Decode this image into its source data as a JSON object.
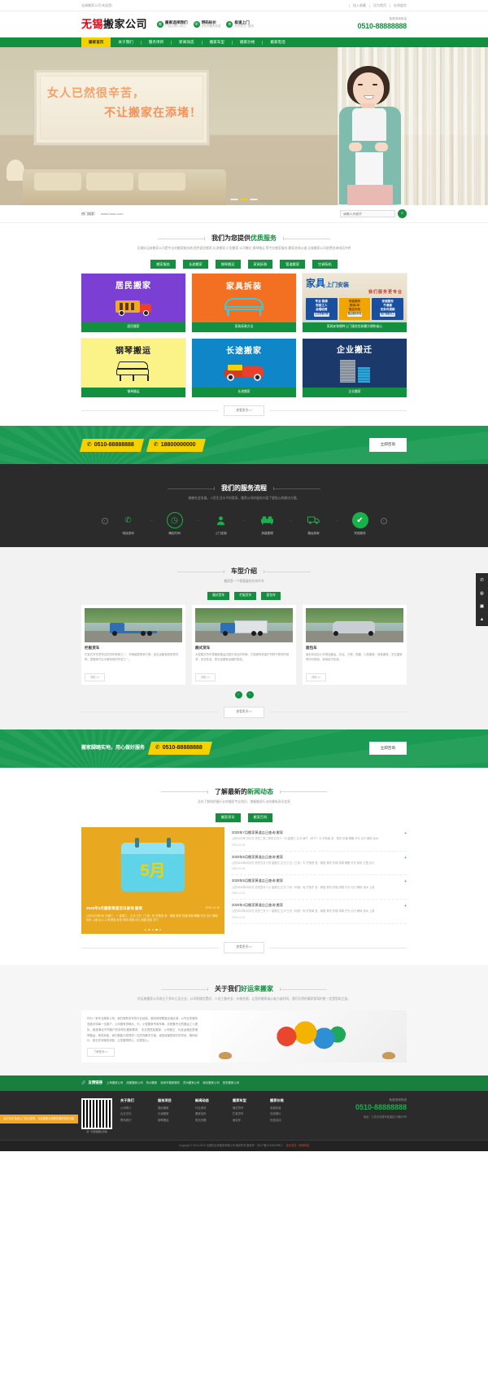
{
  "topbar": {
    "left": "无锡搬家公司 欢迎您!",
    "links": [
      "加入收藏",
      "设为首页",
      "在线留言"
    ]
  },
  "header": {
    "logo_red": "无锡",
    "logo_black": "搬家公司",
    "features": [
      {
        "icon": "shield-icon",
        "glyph": "搬",
        "title": "搬家选择我们",
        "sub": "一百心/舒心/安心"
      },
      {
        "icon": "price-icon",
        "glyph": "明",
        "title": "明码标价",
        "sub": "无任何隐形收费"
      },
      {
        "icon": "fast-icon",
        "glyph": "快",
        "title": "极速上门",
        "sub": "30分钟上门服务"
      }
    ],
    "phone_label": "免费咨询电话",
    "phone_number": "0510-88888888"
  },
  "nav": {
    "items": [
      "搬家首页",
      "关于我们",
      "服务项目",
      "新闻动态",
      "搬家车型",
      "搬家价格",
      "搬家电话"
    ],
    "active": "搬家首页"
  },
  "hero": {
    "line1": "女人已然很辛苦，",
    "line2": "不让搬家在添堵！",
    "slides": 3,
    "active_slide": 1
  },
  "search": {
    "hot_label": "热门搜索：",
    "hot_link": "www.huwz.com",
    "placeholder": "请输入关键字",
    "value": "",
    "button_icon": "search-icon"
  },
  "services": {
    "title_prefix": "我们为您提供",
    "title_accent": "优质服务",
    "subtitle": "无锡好运来搬家公司是专业的搬家服务商,提供居民搬家,长途搬家,小型搬家,公司搬迁,钢琴搬运,等专业搬家服务,搬家咨询公道,无锡搬家公司收费咨询电话中转",
    "tabs": [
      "搬家服务",
      "长途搬家",
      "钢琴搬运",
      "家具拆装",
      "管道搬家",
      "空调拆机"
    ],
    "cards": [
      {
        "title": "居民搬家",
        "caption": "居民搬家",
        "icon": "moving-truck-icon"
      },
      {
        "title": "家具拆装",
        "caption": "家具拆装方法",
        "icon": "bed-frame-icon"
      },
      {
        "title": "家具",
        "title2": "上门安装",
        "subtitle": "我们服务更专业",
        "caption": "家具安装哪种上门服务包装最方便和省心",
        "cols": [
          {
            "l1": "专业·熟练",
            "l2": "安装工人",
            "l3": "合理收费",
            "pill": "点击查看详情"
          },
          {
            "l1": "安装服务",
            "l2": "质保1年",
            "l3": "售后无忧",
            "pill": "售后服务到位"
          },
          {
            "l1": "安装服务",
            "l2": "不满意",
            "l3": "无条件退款",
            "pill": "客户满意至上"
          }
        ]
      },
      {
        "title": "钢琴搬运",
        "caption": "钢琴搬运",
        "icon": "piano-icon"
      },
      {
        "title": "长途搬家",
        "caption": "长途搬家",
        "icon": "pickup-truck-icon"
      },
      {
        "title": "企业搬迁",
        "caption": "企业搬家",
        "icon": "office-building-icon"
      }
    ],
    "more": "查看更多>>"
  },
  "cta1": {
    "phone1": "0510-88888888",
    "phone2": "18800000000",
    "button": "立即咨询",
    "phone_icon": "phone-icon"
  },
  "process": {
    "title": "我们的服务流程",
    "subtitle": "随着社会发展，人民生活水平的提高，搬家公司的服务内容了更贴心的解决方案。",
    "prev_icon": "chevron-left-icon",
    "next_icon": "chevron-right-icon",
    "steps": [
      {
        "label": "电话咨询",
        "icon": "phone-ring-icon",
        "glyph": "✆"
      },
      {
        "label": "确定时间",
        "icon": "clock-icon",
        "glyph": "◷"
      },
      {
        "label": "上门定制",
        "icon": "person-icon",
        "glyph": "●"
      },
      {
        "label": "拆装整理",
        "icon": "sofa-icon",
        "glyph": "▤"
      },
      {
        "label": "搬运到家",
        "icon": "delivery-truck-icon",
        "glyph": "▭"
      },
      {
        "label": "完成服务",
        "icon": "check-circle-icon",
        "glyph": "✔"
      }
    ]
  },
  "vehicles": {
    "title": "车型介绍",
    "subtitle": "搬家是一个需要量的任何环节",
    "tabs": [
      "厢式货车",
      "栏板货车",
      "面包车"
    ],
    "cards": [
      {
        "name": "栏板货车",
        "desc": "栏板式货车是常见的货车种类之一，车辆装载简单方便，适合运输各种常规货物，是搬家作业中最常用的车型之一。",
        "detail": "详情 >>",
        "type": "flat"
      },
      {
        "name": "厢式货车",
        "desc": "大型厢式货车是搬家搬运过程中常见的车辆，它能够有效保护货物不受风吹雨淋，安全性高，是长途搬家运输的首选。",
        "detail": "详情 >>",
        "type": "box"
      },
      {
        "name": "面包车",
        "desc": "面包车适合小件物品搬运，灵活、方便、快捷。小型搬家、宿舍搬家、学生搬家等均可使用，费用经济实惠。",
        "detail": "详情 >>",
        "type": "van"
      }
    ],
    "prev_icon": "chevron-left-icon",
    "next_icon": "chevron-right-icon",
    "more": "查看更多>>",
    "sidebar_icons": [
      "phone-icon",
      "qq-icon",
      "wechat-icon",
      "top-icon"
    ]
  },
  "cta2": {
    "slogan": "搬家脚踏实地，用心做好服务",
    "phone": "0510-88888888",
    "button": "立即咨询",
    "phone_icon": "phone-icon"
  },
  "news": {
    "title_prefix": "了解最新的",
    "title_accent": "新闻动态",
    "subtitle": "及时了解和把握行业的搬家专业知识，掌握搬家行业的最新资讯信息",
    "tabs": [
      "搬家资讯",
      "搬家百科"
    ],
    "feature": {
      "month": "5月",
      "title": "2020年5月搬家黄道吉日查询 搬家",
      "date": "2019-12-10",
      "text": "公历2020年5月 日期三：一 星期三，正冲 己巳（丁亥）蛇 岁煞西 宜：嫁娶 祭祀 祈福 求嗣 斋醮 开光 出行 解除 伐木 上梁 出火 入宅 移徙 安床 拆卸 修造 动土 起基 竖柱 安门",
      "dots": 5,
      "active_dot": 3
    },
    "items": [
      {
        "title": "2020年7月搬家黄道吉日查询 搬家",
        "text": "公历2020年7月1日 农历二零二零年五月十一日 星期三 正冲 庚午（甲子）马 岁煞南 宜：祭祀 祈福 斋醮 开光 出行 解除 伐木",
        "date": "2020-01-05"
      },
      {
        "title": "2020年6月搬家黄道吉日查询 搬家",
        "text": "公历2020年6月5日 农历五月十四 星期五 正冲 乙丑（己未）牛 岁煞西 宜：嫁娶 祭祀 祈福 求嗣 斋醮 开光 纳采 订盟 出行",
        "date": "2020-01-05"
      },
      {
        "title": "2020年5月搬家黄道吉日查询 搬家",
        "text": "公历2020年5月8日 农历四月十六 星期五 正冲 丁卯（辛酉）兔 岁煞东 宜：嫁娶 祭祀 祈福 求嗣 开光 出行 解除 伐木 上梁",
        "date": "2020-12-10"
      },
      {
        "title": "2020年4月搬家黄道吉日查询 搬家",
        "text": "公历2020年4月3日 农历三月十一 星期五 正冲 壬戌（丙辰）狗 岁煞南 宜：嫁娶 祭祀 祈福 求嗣 开光 出行 解除 伐木 上梁",
        "date": "2019-12-10"
      }
    ],
    "more": "查看更多>>"
  },
  "about": {
    "title_prefix": "关于我们",
    "title_accent": "好运来搬家",
    "subtitle": "好运来搬家公司成立于多年立足企业，公司地理位置好，人员工备齐全，价格合理，让您的搬家省心省力省时间，我们为您的搬家保驾护航一定是您的之选。",
    "text": "作为一家专业搬家公司，我们拥有多年的行业经验，服务网络覆盖全城区域，以专业的服务态度对待每一位客户。公司拥有多辆大、中、小型搬家专用车辆，并配备专业的搬运工人团队，能够满足不同客户的多样化搬家需求。\n无论是居民搬家、公司搬迁、长途运输还是钢琴搬运、家具拆装，我们都能为您提供一站式的解决方案。诚信经营是我们的宗旨，明码标价，绝无任何隐性消费，让您搬得舒心、住得放心。",
    "button": "了解更多>>"
  },
  "links": {
    "title": "友情链接",
    "icon": "link-icon",
    "items": [
      "上海搬家公司",
      "成都搬家公司",
      "杭州搬家",
      "深圳市搬家服务",
      "苏州搬家公司",
      "南京搬家公司",
      "西安搬家公司"
    ]
  },
  "footer": {
    "qr_caption": "扫一扫添加微信咨询",
    "columns": [
      {
        "title": "关于我们",
        "items": [
          "公司简介",
          "企业文化",
          "联系我们"
        ]
      },
      {
        "title": "服务项目",
        "items": [
          "居民搬家",
          "长途搬家",
          "钢琴搬运"
        ]
      },
      {
        "title": "新闻动态",
        "items": [
          "行业资讯",
          "搬家百科",
          "常见问题"
        ]
      },
      {
        "title": "搬家车型",
        "items": [
          "厢式货车",
          "栏板货车",
          "面包车"
        ]
      },
      {
        "title": "搬家价格",
        "items": [
          "收费标准",
          "在线报价",
          "优惠活动"
        ]
      }
    ],
    "phone_label": "免费咨询热线",
    "phone_number": "0510-88888888",
    "address": "地址：江苏省无锡市梁溪区XX路XX号",
    "copyright": "Copyright © 2014-2020 无锡好运来搬家有限公司 版权所有 备案号：苏ICP备12345678号-1",
    "tech": "技术支持：网络科技",
    "chat_tip": "点击关闭 免费上门估价咨询，在线客服为您解答搬家相关问题"
  }
}
